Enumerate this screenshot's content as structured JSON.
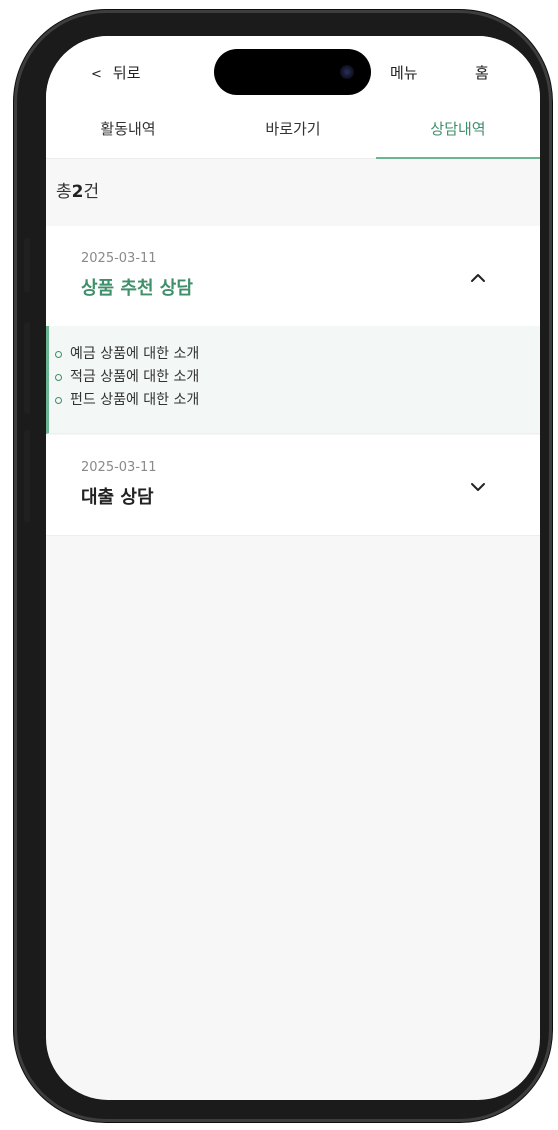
{
  "header": {
    "back_chevron": "<",
    "back_label": "뒤로",
    "menu_label": "메뉴",
    "home_label": "홈"
  },
  "tabs": [
    {
      "label": "활동내역",
      "active": false
    },
    {
      "label": "바로가기",
      "active": false
    },
    {
      "label": "상담내역",
      "active": true
    }
  ],
  "summary": {
    "prefix": "총",
    "count": "2",
    "suffix": "건"
  },
  "consultations": [
    {
      "date": "2025-03-11",
      "title": "상품 추천 상담",
      "expanded": true,
      "toggle_icon": "chevron-up-icon",
      "details": [
        "예금 상품에 대한 소개",
        "적금 상품에 대한 소개",
        "펀드 상품에 대한 소개"
      ]
    },
    {
      "date": "2025-03-11",
      "title": "대출 상담",
      "expanded": false,
      "toggle_icon": "chevron-down-icon"
    }
  ],
  "colors": {
    "accent": "#3f8f6a",
    "accent_line": "#6bb592",
    "detail_bg": "#f3f7f5",
    "screen_bg": "#f7f7f7"
  }
}
